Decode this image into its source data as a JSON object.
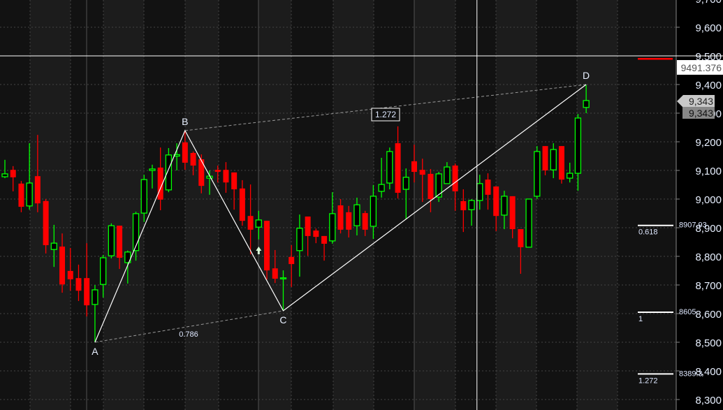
{
  "chart_data": {
    "type": "candlestick",
    "title": "",
    "ylim": [
      8260,
      9710
    ],
    "y_ticks": [
      8300,
      8400,
      8500,
      8600,
      8700,
      8800,
      8900,
      9000,
      9100,
      9200,
      9300,
      9400,
      9500,
      9600,
      9700
    ],
    "y_tick_labels": [
      "8,300",
      "8,400",
      "8,500",
      "8,600",
      "8,700",
      "8,800",
      "8,900",
      "9,000",
      "9,100",
      "9,200",
      "9,300",
      "9,400",
      "9,500",
      "9,600",
      "9,700"
    ],
    "grid": true,
    "colors": {
      "up": "#00ff00",
      "down": "#ff0000",
      "pattern": "#ffffff",
      "crosshair": "#ffffff",
      "marker": "#ff0000"
    },
    "candles": [
      [
        9078,
        9137,
        9073,
        9088
      ],
      [
        9102,
        9115,
        9027,
        9076
      ],
      [
        9054,
        9063,
        8954,
        8973
      ],
      [
        8976,
        9195,
        8963,
        9056
      ],
      [
        9080,
        9224,
        8954,
        8985
      ],
      [
        8993,
        9000,
        8810,
        8839
      ],
      [
        8824,
        8910,
        8763,
        8846
      ],
      [
        8834,
        8880,
        8673,
        8702
      ],
      [
        8749,
        8829,
        8680,
        8720
      ],
      [
        8724,
        8771,
        8644,
        8680
      ],
      [
        8724,
        8846,
        8590,
        8629
      ],
      [
        8632,
        8700,
        8500,
        8683
      ],
      [
        8702,
        8805,
        8656,
        8795
      ],
      [
        8802,
        8915,
        8793,
        8907
      ],
      [
        8907,
        8907,
        8756,
        8795
      ],
      [
        8778,
        8820,
        8705,
        8815
      ],
      [
        8820,
        8956,
        8785,
        8949
      ],
      [
        8951,
        9085,
        8920,
        9068
      ],
      [
        9100,
        9120,
        9037,
        9105
      ],
      [
        9110,
        9180,
        8961,
        8998
      ],
      [
        9032,
        9178,
        9024,
        9154
      ],
      [
        9150,
        9195,
        9100,
        9155
      ],
      [
        9198,
        9239,
        9102,
        9127
      ],
      [
        9161,
        9166,
        9083,
        9117
      ],
      [
        9139,
        9156,
        9020,
        9046
      ],
      [
        9073,
        9100,
        9015,
        9080
      ],
      [
        9102,
        9117,
        9058,
        9095
      ],
      [
        9102,
        9129,
        9022,
        9058
      ],
      [
        9093,
        9093,
        8963,
        9034
      ],
      [
        9037,
        9066,
        8907,
        8924
      ],
      [
        8941,
        9051,
        8807,
        8893
      ],
      [
        8902,
        8959,
        8859,
        8927
      ],
      [
        8924,
        8924,
        8719,
        8751
      ],
      [
        8758,
        8822,
        8707,
        8722
      ],
      [
        8722,
        8751,
        8610,
        8725
      ],
      [
        8798,
        8839,
        8693,
        8773
      ],
      [
        8820,
        8946,
        8729,
        8898
      ],
      [
        8939,
        8939,
        8802,
        8871
      ],
      [
        8890,
        8897,
        8846,
        8868
      ],
      [
        8871,
        8871,
        8785,
        8844
      ],
      [
        8854,
        9024,
        8844,
        8949
      ],
      [
        8978,
        9000,
        8880,
        8893
      ],
      [
        8954,
        8976,
        8866,
        8893
      ],
      [
        8907,
        9005,
        8873,
        8980
      ],
      [
        8951,
        8959,
        8871,
        8893
      ],
      [
        8905,
        9049,
        8861,
        9010
      ],
      [
        9027,
        9144,
        9005,
        9051
      ],
      [
        9056,
        9180,
        9034,
        9166
      ],
      [
        9195,
        9254,
        9002,
        9022
      ],
      [
        9034,
        9107,
        8929,
        9076
      ],
      [
        9132,
        9190,
        9058,
        9095
      ],
      [
        9102,
        9141,
        8990,
        9085
      ],
      [
        9088,
        9105,
        8954,
        9000
      ],
      [
        9007,
        9095,
        8990,
        9088
      ],
      [
        9054,
        9129,
        9054,
        9112
      ],
      [
        9117,
        9124,
        8959,
        9027
      ],
      [
        8993,
        9034,
        8885,
        8961
      ],
      [
        8963,
        9000,
        8907,
        8995
      ],
      [
        8995,
        9085,
        8963,
        9054
      ],
      [
        9068,
        9090,
        8963,
        9015
      ],
      [
        9044,
        9044,
        8888,
        8941
      ],
      [
        8944,
        9029,
        8895,
        9010
      ],
      [
        9010,
        9010,
        8863,
        8895
      ],
      [
        8895,
        8895,
        8739,
        8832
      ],
      [
        8832,
        9000,
        8832,
        9000
      ],
      [
        9010,
        9185,
        9000,
        9166
      ],
      [
        9185,
        9185,
        9083,
        9100
      ],
      [
        9102,
        9195,
        9073,
        9173
      ],
      [
        9185,
        9185,
        9054,
        9068
      ],
      [
        9073,
        9127,
        9058,
        9090
      ],
      [
        9090,
        9297,
        9029,
        9283
      ],
      [
        9320,
        9398,
        9300,
        9344
      ]
    ],
    "candle_format": [
      "open",
      "high",
      "low",
      "close"
    ],
    "pattern": {
      "points": [
        {
          "label": "A",
          "index": 11,
          "price": 8500
        },
        {
          "label": "B",
          "index": 22,
          "price": 9239
        },
        {
          "label": "C",
          "index": 34,
          "price": 8610
        },
        {
          "label": "D",
          "index": 71,
          "price": 9400
        }
      ],
      "ratios": [
        {
          "label": "0.786",
          "from": "A",
          "to": "C"
        },
        {
          "label": "1.272",
          "from": "B",
          "to": "D"
        }
      ]
    },
    "fib_levels": [
      {
        "ratio": "0.618",
        "price": 8907.93,
        "price_label": "8907.93"
      },
      {
        "ratio": "1",
        "price": 8605,
        "price_label": "8605"
      },
      {
        "ratio": "1.272",
        "price": 8389.3,
        "price_label": "8389.3"
      }
    ],
    "crosshair": {
      "price": 9491.376,
      "label": "9491.376",
      "index": 58
    },
    "last_price": {
      "value": 9343,
      "label": "9,343",
      "label2": "9,343"
    },
    "marker_price": 9492,
    "signal_arrow": {
      "index": 31,
      "direction": "up"
    }
  }
}
